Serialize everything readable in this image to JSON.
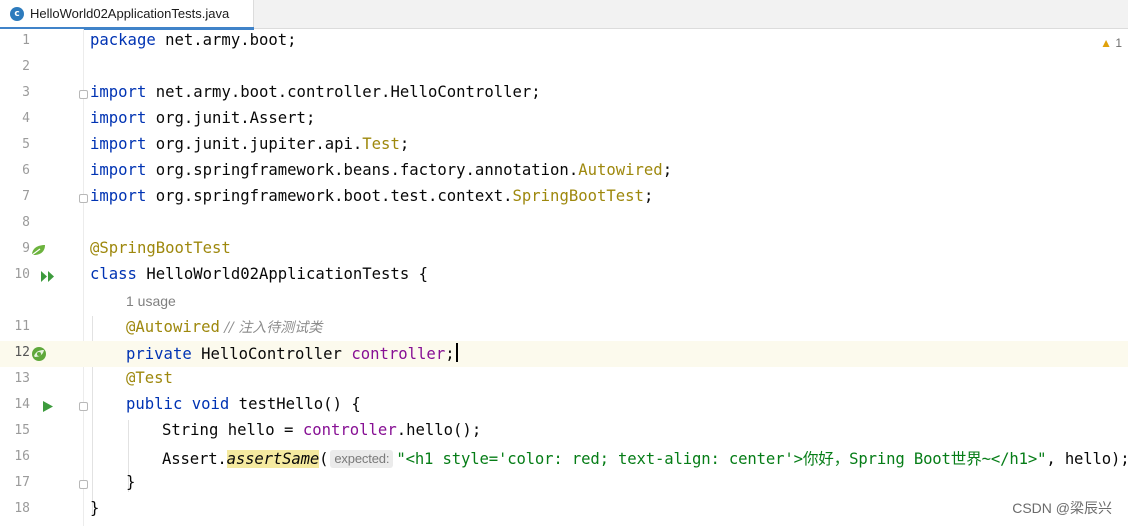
{
  "tab": {
    "icon_letter": "c",
    "title": "HelloWorld02ApplicationTests.java"
  },
  "inspection": {
    "icon": "warning-triangle-icon",
    "count": "1"
  },
  "watermark": "CSDN @梁辰兴",
  "editor": {
    "current_line": 12,
    "usage_hint": "1 usage",
    "param_hint": "expected:",
    "line_numbers": [
      "1",
      "2",
      "3",
      "4",
      "5",
      "6",
      "7",
      "8",
      "9",
      "10",
      "11",
      "12",
      "13",
      "14",
      "15",
      "16",
      "17",
      "18"
    ],
    "lines": {
      "l1": {
        "kw": "package",
        "rest": " net.army.boot;"
      },
      "l3": {
        "kw": "import",
        "rest": " net.army.boot.controller.HelloController;"
      },
      "l4": {
        "kw": "import",
        "rest": " org.junit.Assert;"
      },
      "l5": {
        "kw": "import",
        "rest": " org.junit.jupiter.api.",
        "ann": "Test",
        "end": ";"
      },
      "l6": {
        "kw": "import",
        "rest": " org.springframework.beans.factory.annotation.",
        "ann": "Autowired",
        "end": ";"
      },
      "l7": {
        "kw": "import",
        "rest": " org.springframework.boot.test.context.",
        "ann": "SpringBootTest",
        "end": ";"
      },
      "l9": {
        "ann": "@SpringBootTest"
      },
      "l10": {
        "kw": "class",
        "rest": " HelloWorld02ApplicationTests {"
      },
      "l11": {
        "ann": "@Autowired",
        "cmt": " // 注入待测试类"
      },
      "l12": {
        "kw": "private",
        "rest": " HelloController ",
        "fld": "controller",
        "end": ";"
      },
      "l13": {
        "ann": "@Test"
      },
      "l14": {
        "kw1": "public",
        "kw2": " void",
        "rest": " testHello() {"
      },
      "l15": {
        "rest": "String hello = ",
        "fld": "controller",
        "end": ".hello();"
      },
      "l16": {
        "pre": "Assert.",
        "fn": "assertSame",
        "open": "(",
        "str": "\"<h1 style='color: red; text-align: center'>你好，Spring Boot世界~</h1>\"",
        "end": ", hello);"
      },
      "l17": {
        "rest": "}"
      },
      "l18": {
        "rest": "}"
      }
    }
  },
  "colors": {
    "keyword": "#0033b3",
    "annotation": "#9e880d",
    "field": "#871094",
    "comment": "#8c8c8c",
    "string": "#067d17",
    "current_line": "#fcfaed",
    "tab_accent": "#4083c9"
  }
}
